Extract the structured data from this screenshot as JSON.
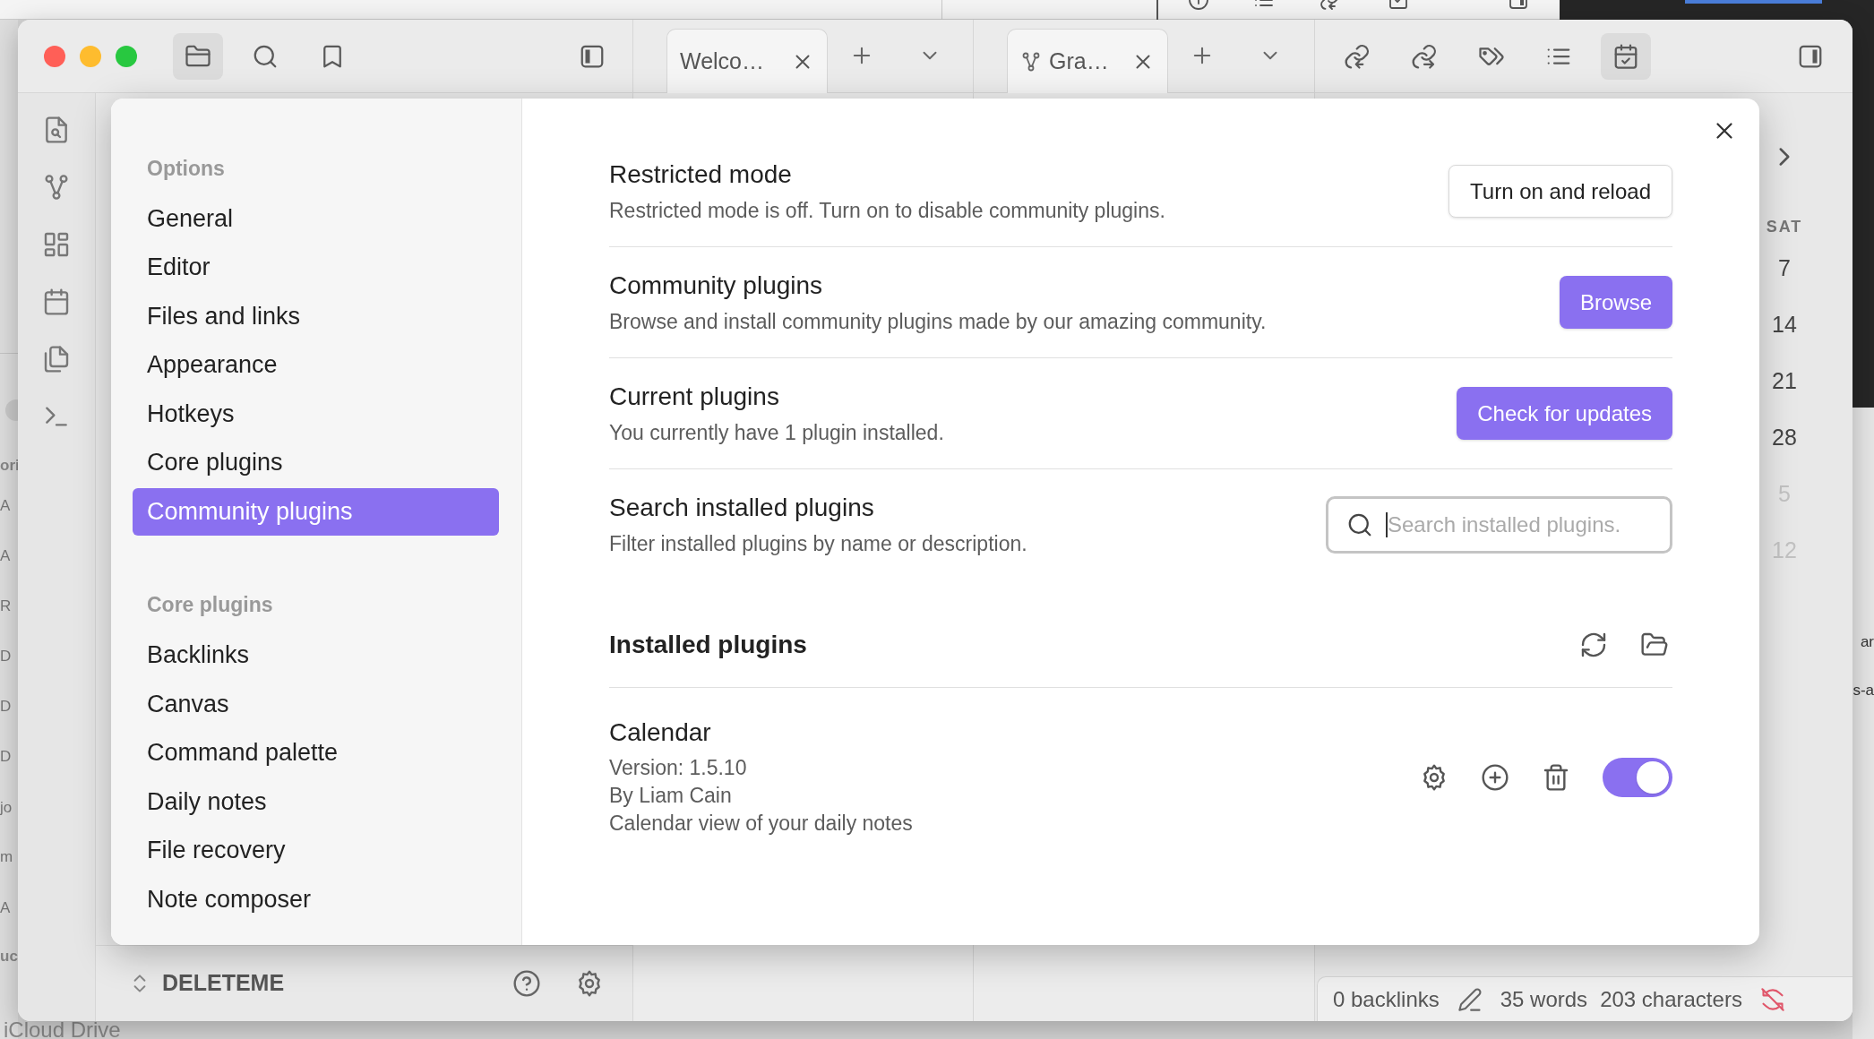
{
  "background": {
    "left_fragments": [
      "ori",
      "A",
      "A",
      "R",
      "D",
      "D",
      "D",
      "jo",
      "m",
      "A",
      "uc"
    ],
    "bottom_fragment": "iCloud Drive",
    "right_fragments": [
      "ar",
      "s-a"
    ]
  },
  "titlebar": {
    "left_buttons": [
      {
        "selected": true
      },
      {
        "selected": false
      },
      {
        "selected": false
      }
    ],
    "tabs": [
      {
        "label": "Welco…"
      },
      {
        "label": "Gra…"
      }
    ],
    "right_buttons": [
      {
        "selected": false
      },
      {
        "selected": false
      },
      {
        "selected": false
      },
      {
        "selected": false
      },
      {
        "selected": true
      }
    ]
  },
  "left_sidebar": {
    "vault": "DELETEME"
  },
  "calendar": {
    "weekday": "SAT",
    "days": [
      {
        "label": "7",
        "other_month": false
      },
      {
        "label": "14",
        "other_month": false
      },
      {
        "label": "21",
        "other_month": false
      },
      {
        "label": "28",
        "other_month": false
      },
      {
        "label": "5",
        "other_month": true
      },
      {
        "label": "12",
        "other_month": true
      }
    ]
  },
  "status_bar": {
    "backlinks": "0 backlinks",
    "words": "35 words",
    "characters": "203 characters"
  },
  "settings_modal": {
    "sidebar": [
      {
        "title": "Options",
        "items": [
          {
            "label": "General",
            "selected": false
          },
          {
            "label": "Editor",
            "selected": false
          },
          {
            "label": "Files and links",
            "selected": false
          },
          {
            "label": "Appearance",
            "selected": false
          },
          {
            "label": "Hotkeys",
            "selected": false
          },
          {
            "label": "Core plugins",
            "selected": false
          },
          {
            "label": "Community plugins",
            "selected": true
          }
        ]
      },
      {
        "title": "Core plugins",
        "items": [
          {
            "label": "Backlinks",
            "selected": false
          },
          {
            "label": "Canvas",
            "selected": false
          },
          {
            "label": "Command palette",
            "selected": false
          },
          {
            "label": "Daily notes",
            "selected": false
          },
          {
            "label": "File recovery",
            "selected": false
          },
          {
            "label": "Note composer",
            "selected": false
          }
        ]
      }
    ],
    "settings": [
      {
        "name": "Restricted mode",
        "description": "Restricted mode is off. Turn on to disable community plugins.",
        "kind": "button",
        "label": "Turn on and reload"
      },
      {
        "name": "Community plugins",
        "description": "Browse and install community plugins made by our amazing community.",
        "kind": "cta",
        "label": "Browse"
      },
      {
        "name": "Current plugins",
        "description": "You currently have 1 plugin installed.",
        "kind": "cta",
        "label": "Check for updates"
      },
      {
        "name": "Search installed plugins",
        "description": "Filter installed plugins by name or description.",
        "kind": "search",
        "placeholder": "Search installed plugins."
      }
    ],
    "installed": {
      "heading": "Installed plugins",
      "plugins": [
        {
          "name": "Calendar",
          "details": [
            "Version: 1.5.10",
            "By Liam Cain",
            "Calendar view of your daily notes"
          ],
          "enabled": true
        }
      ]
    }
  }
}
